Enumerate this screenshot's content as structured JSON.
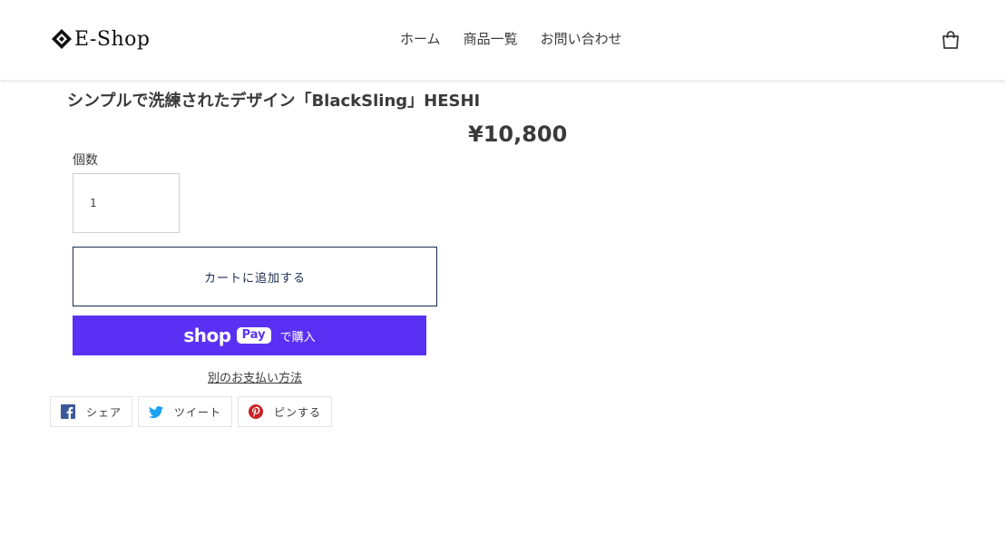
{
  "header": {
    "logo_text": "E-Shop",
    "nav": [
      "ホーム",
      "商品一覧",
      "お問い合わせ"
    ]
  },
  "product": {
    "title": "シンプルで洗練されたデザイン「BlackSling」HESHI",
    "price": "¥10,800",
    "quantity_label": "個数",
    "quantity_value": "1",
    "add_to_cart_label": "カートに追加する",
    "shop_pay": {
      "shop_word": "shop",
      "pay_word": "Pay",
      "buy_label": "で購入",
      "color": "#5a31f4"
    },
    "alt_payment_label": "別のお支払い方法"
  },
  "share": {
    "facebook_label": "シェア",
    "twitter_label": "ツイート",
    "pinterest_label": "ピンする"
  },
  "colors": {
    "accent_dark": "#1a2b4f",
    "facebook": "#3b5998",
    "twitter": "#1da1f2",
    "pinterest": "#cb2027"
  },
  "icons": [
    "logo-diamond-icon",
    "cart-icon",
    "facebook-icon",
    "twitter-icon",
    "pinterest-icon"
  ]
}
